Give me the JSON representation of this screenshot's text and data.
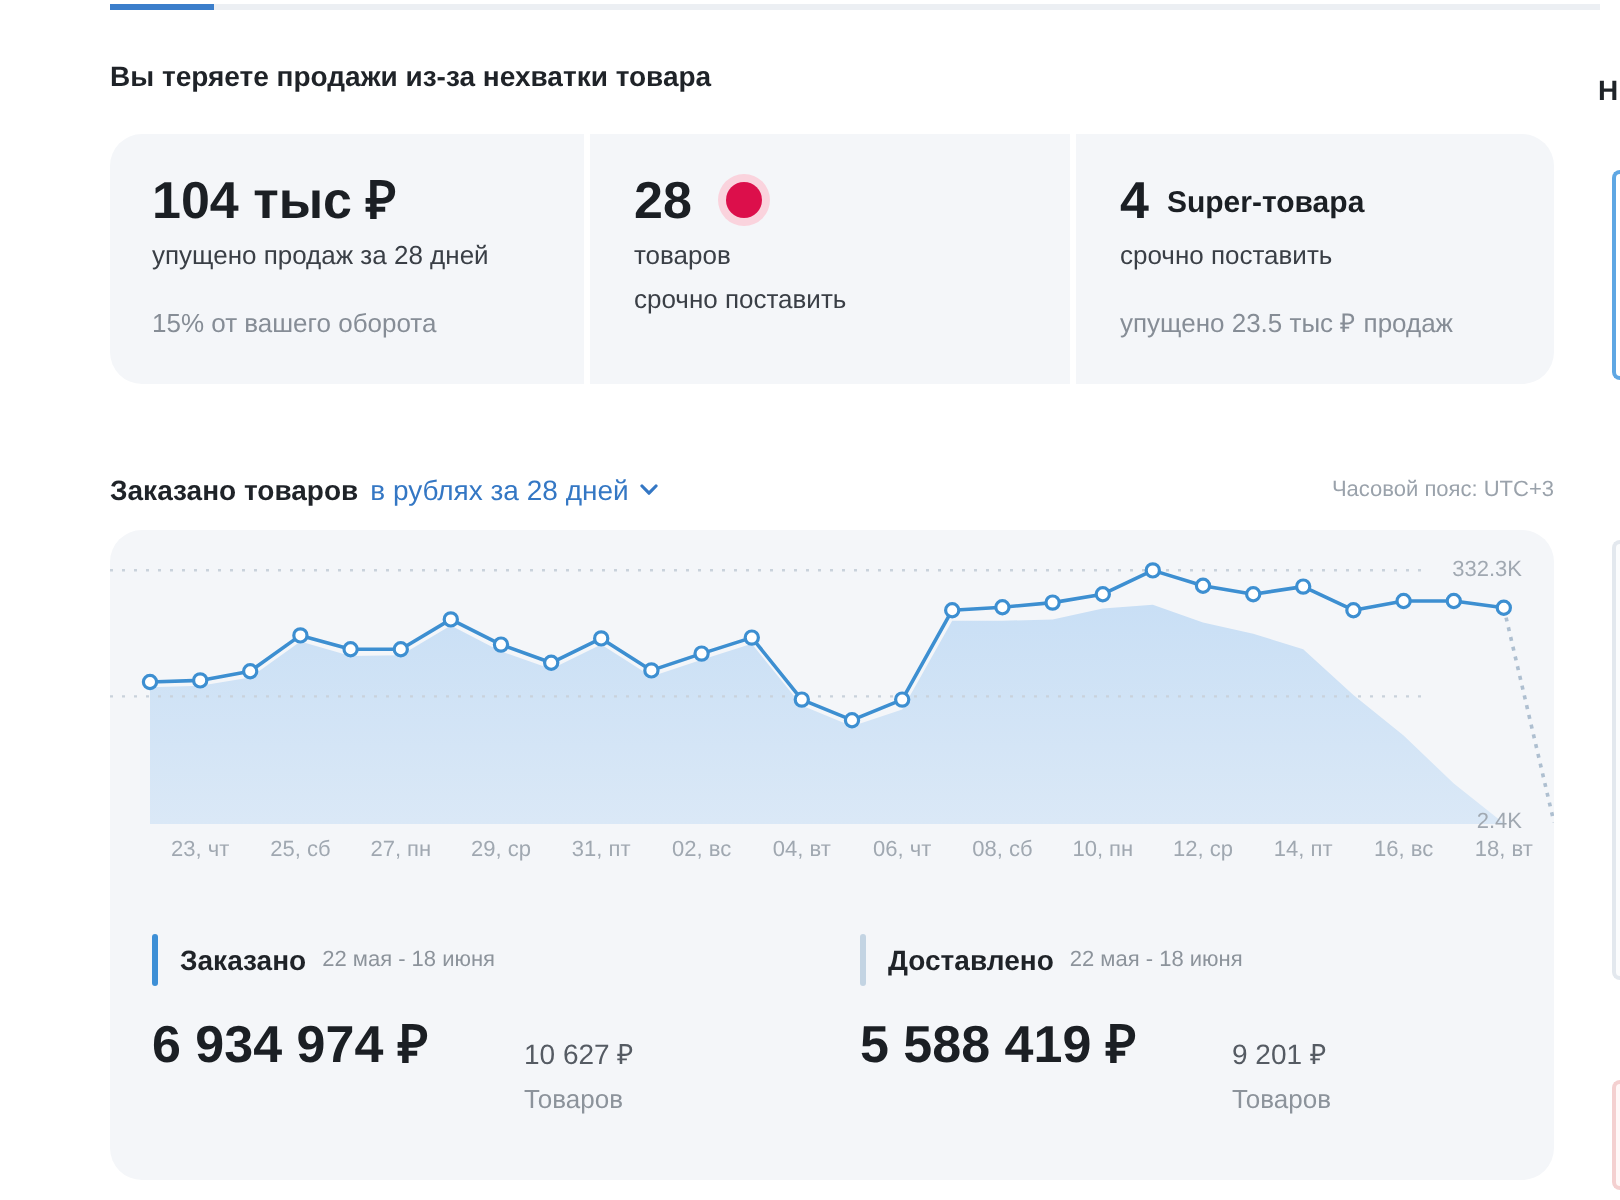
{
  "heading": "Вы теряете продажи из-за нехватки товара",
  "stats": [
    {
      "value": "104 тыс ₽",
      "alert": false,
      "caption": [
        "упущено продаж за 28 дней"
      ],
      "note": "15% от вашего оборота"
    },
    {
      "value": "28",
      "alert": true,
      "caption": [
        "товаров",
        "срочно поставить"
      ]
    },
    {
      "value": "4",
      "unit": "Super-товара",
      "alert": false,
      "caption": [
        "срочно поставить"
      ],
      "note": "упущено 23.5 тыс ₽ продаж"
    }
  ],
  "chart_section": {
    "title": "Заказано товаров",
    "period_link": "в рублях за 28 дней",
    "timezone": "Часовой пояс: UTC+3",
    "chart_data": {
      "type": "line",
      "categories": [
        null,
        "23, чт",
        null,
        "25, сб",
        null,
        "27, пн",
        null,
        "29, ср",
        null,
        "31, пт",
        null,
        "02, вс",
        null,
        "04, вт",
        null,
        "06, чт",
        null,
        "08, сб",
        null,
        "10, пн",
        null,
        "12, ср",
        null,
        "14, пт",
        null,
        "16, вс",
        null,
        "18, вт",
        null
      ],
      "ylim": [
        -76000,
        385000
      ],
      "yticks": [
        {
          "value": 2400,
          "label": "2.4K"
        },
        {
          "value": 332300,
          "label": "332.3K"
        }
      ],
      "ref_lines": [
        {
          "axis": "y",
          "value": 167000
        }
      ],
      "series": [
        {
          "type": "area",
          "color": "#c9dff5",
          "values": [
            179000,
            181000,
            192000,
            239000,
            220000,
            221000,
            260000,
            226000,
            203000,
            235000,
            193000,
            215000,
            236000,
            155000,
            128000,
            150000,
            266000,
            266000,
            268000,
            282000,
            287000,
            264000,
            249000,
            229000,
            169000,
            116000,
            53000,
            1000,
            null
          ]
        },
        {
          "type": "line",
          "marker": "o",
          "color": "#3d8fd1",
          "values": [
            186000,
            188000,
            200000,
            247000,
            229000,
            229000,
            268000,
            235000,
            211000,
            243000,
            201000,
            223000,
            244000,
            163000,
            136000,
            163000,
            280000,
            284000,
            290000,
            301000,
            332000,
            312000,
            301000,
            311000,
            280000,
            292000,
            292000,
            283000,
            null
          ]
        },
        {
          "type": "line",
          "line_style": "dashed",
          "color": "#aebfd0",
          "values": [
            null,
            null,
            null,
            null,
            null,
            null,
            null,
            null,
            null,
            null,
            null,
            null,
            null,
            null,
            null,
            null,
            null,
            null,
            null,
            null,
            null,
            null,
            null,
            null,
            null,
            null,
            null,
            283000,
            2000
          ]
        }
      ]
    }
  },
  "summary": [
    {
      "label": "Заказано",
      "period": "22 мая - 18 июня",
      "total": "6 934 974 ₽",
      "count": "10 627 ₽",
      "count_label": "Товаров",
      "color": "#3d8fd6"
    },
    {
      "label": "Доставлено",
      "period": "22 мая - 18 июня",
      "total": "5 588 419 ₽",
      "count": "9 201 ₽",
      "count_label": "Товаров",
      "color": "#c3d4e3"
    }
  ],
  "right_panel": {
    "title": "Н",
    "cards": [
      {
        "kind": "highlight"
      },
      {
        "kind": "plain"
      },
      {
        "kind": "warning"
      }
    ]
  }
}
